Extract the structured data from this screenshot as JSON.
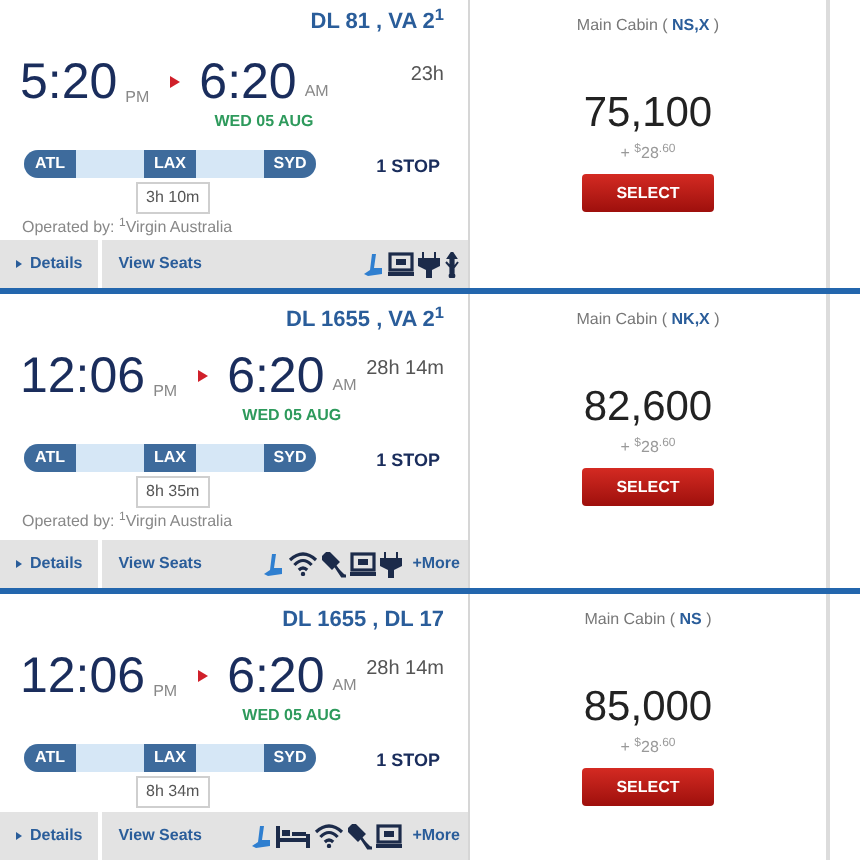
{
  "flights": [
    {
      "flight_numbers": "DL 81 , VA 2$^{1}$",
      "depart_time": "5:20",
      "depart_ampm": "PM",
      "arrive_time": "6:20",
      "arrive_ampm": "AM",
      "arrive_date": "WED 05 AUG",
      "duration": "23h",
      "airports": [
        "ATL",
        "LAX",
        "SYD"
      ],
      "layover": "3h 10m",
      "stops": "1 STOP",
      "operated_by": "Operated by: $^{1}$Virgin Australia",
      "details": "Details",
      "view_seats": "View Seats",
      "amenities": [
        {
          "kind": "seat"
        },
        {
          "kind": "screen"
        },
        {
          "kind": "power"
        },
        {
          "kind": "usb"
        }
      ],
      "cabin": "Main Cabin (",
      "fare_code": "NS,X",
      "cabin_close": ")",
      "price": "75,100",
      "taxes_sign": "+",
      "taxes_currency": "$",
      "taxes_amount": "28",
      "taxes_cents": ".60",
      "select": "SELECT"
    },
    {
      "flight_numbers": "DL 1655 , VA 2$^{1}$",
      "depart_time": "12:06",
      "depart_ampm": "PM",
      "arrive_time": "6:20",
      "arrive_ampm": "AM",
      "arrive_date": "WED 05 AUG",
      "duration": "28h 14m",
      "airports": [
        "ATL",
        "LAX",
        "SYD"
      ],
      "layover": "8h 35m",
      "stops": "1 STOP",
      "operated_by": "Operated by: $^{1}$Virgin Australia",
      "details": "Details",
      "view_seats": "View Seats",
      "amenities": [
        {
          "kind": "seat"
        },
        {
          "kind": "wifi"
        },
        {
          "kind": "satellite"
        },
        {
          "kind": "screen"
        },
        {
          "kind": "power"
        }
      ],
      "more": "+More",
      "cabin": "Main Cabin (",
      "fare_code": "NK,X",
      "cabin_close": ")",
      "price": "82,600",
      "taxes_sign": "+",
      "taxes_currency": "$",
      "taxes_amount": "28",
      "taxes_cents": ".60",
      "select": "SELECT"
    },
    {
      "flight_numbers": "DL 1655 , DL 17",
      "depart_time": "12:06",
      "depart_ampm": "PM",
      "arrive_time": "6:20",
      "arrive_ampm": "AM",
      "arrive_date": "WED 05 AUG",
      "duration": "28h 14m",
      "airports": [
        "ATL",
        "LAX",
        "SYD"
      ],
      "layover": "8h 34m",
      "stops": "1 STOP",
      "details": "Details",
      "view_seats": "View Seats",
      "amenities": [
        {
          "kind": "seat"
        },
        {
          "kind": "bed"
        },
        {
          "kind": "wifi"
        },
        {
          "kind": "satellite"
        },
        {
          "kind": "screen"
        }
      ],
      "more": "+More",
      "cabin": "Main Cabin (",
      "fare_code": "NS",
      "cabin_close": ")",
      "price": "85,000",
      "taxes_sign": "+",
      "taxes_currency": "$",
      "taxes_amount": "28",
      "taxes_cents": ".60",
      "select": "SELECT"
    }
  ]
}
